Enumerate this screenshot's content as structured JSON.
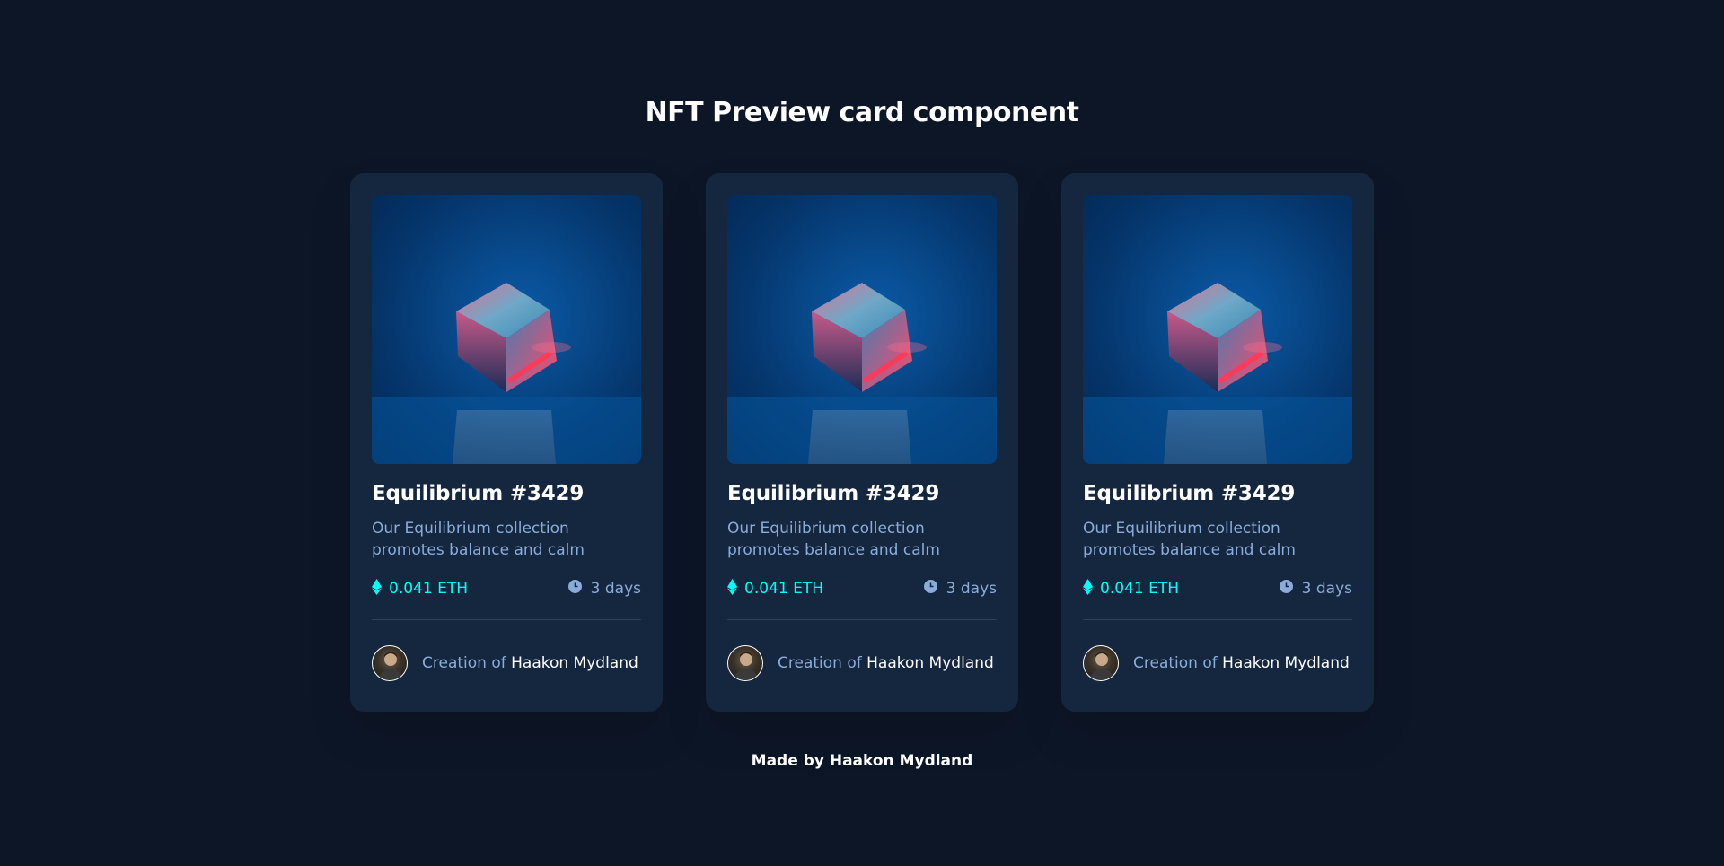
{
  "page": {
    "title": "NFT Preview card component",
    "footer": "Made by Haakon Mydland"
  },
  "colors": {
    "background": "#0d1627",
    "card": "#15263f",
    "accent_cyan": "#00fff8",
    "soft_blue": "#8bacd9",
    "white": "#ffffff"
  },
  "cards": [
    {
      "title": "Equilibrium #3429",
      "description": "Our Equilibrium collection promotes balance and calm",
      "price": "0.041 ETH",
      "time_left": "3 days",
      "creator_prefix": "Creation of",
      "creator_name": "Haakon Mydland",
      "price_icon": "ethereum-icon",
      "time_icon": "clock-icon"
    },
    {
      "title": "Equilibrium #3429",
      "description": "Our Equilibrium collection promotes balance and calm",
      "price": "0.041 ETH",
      "time_left": "3 days",
      "creator_prefix": "Creation of",
      "creator_name": "Haakon Mydland",
      "price_icon": "ethereum-icon",
      "time_icon": "clock-icon"
    },
    {
      "title": "Equilibrium #3429",
      "description": "Our Equilibrium collection promotes balance and calm",
      "price": "0.041 ETH",
      "time_left": "3 days",
      "creator_prefix": "Creation of",
      "creator_name": "Haakon Mydland",
      "price_icon": "ethereum-icon",
      "time_icon": "clock-icon"
    }
  ]
}
